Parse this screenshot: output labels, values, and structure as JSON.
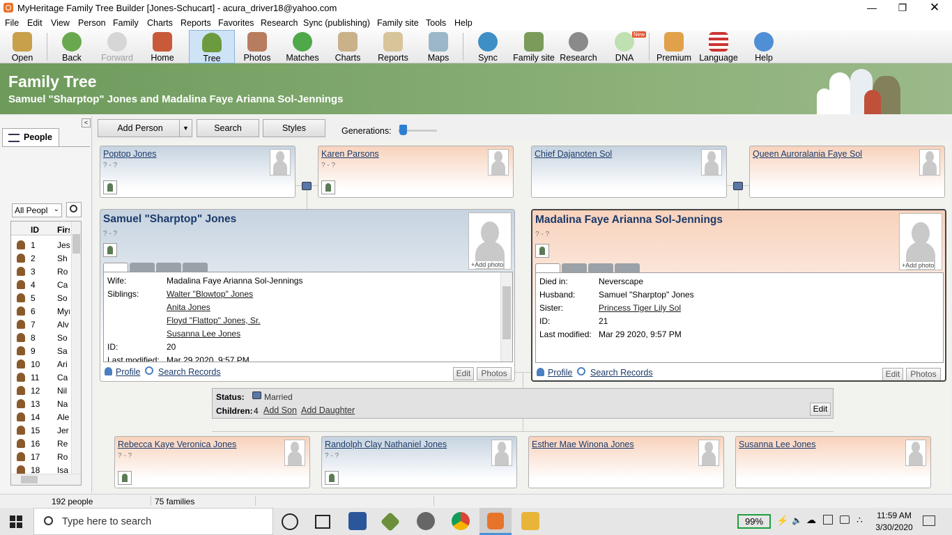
{
  "window": {
    "title": "MyHeritage Family Tree Builder [Jones-Schucart] - acura_driver18@yahoo.com"
  },
  "menu": [
    "File",
    "Edit",
    "View",
    "Person",
    "Family",
    "Charts",
    "Reports",
    "Favorites",
    "Research",
    "Sync (publishing)",
    "Family site",
    "Tools",
    "Help"
  ],
  "toolbar": {
    "items": [
      {
        "label": "Open",
        "icon": "folder-icon"
      },
      {
        "label": "Back",
        "icon": "back-arrow-icon"
      },
      {
        "label": "Forward",
        "icon": "forward-arrow-icon"
      },
      {
        "label": "Home",
        "icon": "house-icon"
      },
      {
        "label": "Tree",
        "icon": "tree-icon"
      },
      {
        "label": "Photos",
        "icon": "photos-icon"
      },
      {
        "label": "Matches",
        "icon": "matches-icon"
      },
      {
        "label": "Charts",
        "icon": "charts-icon"
      },
      {
        "label": "Reports",
        "icon": "reports-icon"
      },
      {
        "label": "Maps",
        "icon": "maps-icon"
      },
      {
        "label": "Sync",
        "icon": "sync-icon"
      },
      {
        "label": "Family site",
        "icon": "family-site-icon"
      },
      {
        "label": "Research",
        "icon": "research-icon"
      },
      {
        "label": "DNA",
        "icon": "dna-icon"
      },
      {
        "label": "Premium",
        "icon": "premium-icon"
      },
      {
        "label": "Language",
        "icon": "flag-icon"
      },
      {
        "label": "Help",
        "icon": "help-icon"
      }
    ],
    "new_badge": "New"
  },
  "banner": {
    "title": "Family Tree",
    "subtitle": "Samuel \"Sharptop\" Jones and Madalina Faye Arianna Sol-Jennings"
  },
  "left_panel": {
    "tab_label": "People",
    "filter_value": "All Peopl",
    "col_id": "ID",
    "col_first": "Firs",
    "rows": [
      {
        "id": "1",
        "name": "Jes"
      },
      {
        "id": "2",
        "name": "Sh"
      },
      {
        "id": "3",
        "name": "Ro"
      },
      {
        "id": "4",
        "name": "Ca"
      },
      {
        "id": "5",
        "name": "So"
      },
      {
        "id": "6",
        "name": "Myı"
      },
      {
        "id": "7",
        "name": "Alv"
      },
      {
        "id": "8",
        "name": "So"
      },
      {
        "id": "9",
        "name": "Sa"
      },
      {
        "id": "10",
        "name": "Ari"
      },
      {
        "id": "11",
        "name": "Ca"
      },
      {
        "id": "12",
        "name": "Nil"
      },
      {
        "id": "13",
        "name": "Na"
      },
      {
        "id": "14",
        "name": "Ale"
      },
      {
        "id": "15",
        "name": "Jer"
      },
      {
        "id": "16",
        "name": "Re"
      },
      {
        "id": "17",
        "name": "Ro"
      },
      {
        "id": "18",
        "name": "Isa"
      }
    ]
  },
  "controls": {
    "add_person": "Add Person",
    "search": "Search",
    "styles": "Styles",
    "generations_label": "Generations:",
    "generations_level": 0.1
  },
  "parents": [
    {
      "name": "Poptop Jones",
      "dates": "? - ?"
    },
    {
      "name": "Karen Parsons",
      "dates": "? - ?"
    },
    {
      "name": "Chief Dajanoten Sol",
      "dates": ""
    },
    {
      "name": "Queen Auroralania Faye Sol",
      "dates": ""
    }
  ],
  "husband": {
    "name": "Samuel \"Sharptop\" Jones",
    "dates": "? - ?",
    "add_photo": "Add photo",
    "rows": [
      {
        "k": "Wife:",
        "v": "Madalina Faye Arianna Sol-Jennings",
        "link": false
      },
      {
        "k": "Siblings:",
        "v": "Walter \"Blowtop\" Jones",
        "link": true
      },
      {
        "k": "",
        "v": "Anita Jones",
        "link": true
      },
      {
        "k": "",
        "v": "Floyd \"Flattop\" Jones, Sr.",
        "link": true
      },
      {
        "k": "",
        "v": "Susanna Lee Jones",
        "link": true
      },
      {
        "k": "ID:",
        "v": "20",
        "link": false
      },
      {
        "k": "Last modified:",
        "v": "Mar 29 2020, 9:57 PM",
        "link": false
      }
    ],
    "profile": "Profile",
    "search_records": "Search Records",
    "edit": "Edit",
    "photos": "Photos"
  },
  "wife": {
    "name": "Madalina Faye Arianna Sol-Jennings",
    "dates": "? - ?",
    "add_photo": "Add photo",
    "rows": [
      {
        "k": "Died in:",
        "v": "Neverscape",
        "link": false
      },
      {
        "k": "Husband:",
        "v": "Samuel \"Sharptop\" Jones",
        "link": false
      },
      {
        "k": "Sister:",
        "v": "Princess Tiger Lily Sol",
        "link": true
      },
      {
        "k": "ID:",
        "v": "21",
        "link": false
      },
      {
        "k": "Last modified:",
        "v": "Mar 29 2020, 9:57 PM",
        "link": false
      }
    ],
    "profile": "Profile",
    "search_records": "Search Records",
    "edit": "Edit",
    "photos": "Photos"
  },
  "family": {
    "status_label": "Status:",
    "status_value": "Married",
    "children_label": "Children:",
    "children_count": "4",
    "add_son": "Add Son",
    "add_daughter": "Add Daughter",
    "edit": "Edit"
  },
  "children": [
    {
      "name": "Rebecca Kaye Veronica Jones",
      "dates": "? - ?",
      "sex": "f"
    },
    {
      "name": "Randolph Clay Nathaniel Jones",
      "dates": "? - ?",
      "sex": "m"
    },
    {
      "name": "Esther Mae Winona Jones",
      "dates": "",
      "sex": "f"
    },
    {
      "name": "Susanna Lee Jones",
      "dates": "",
      "sex": "f"
    }
  ],
  "statusbar": {
    "people": "192 people",
    "families": "75 families"
  },
  "taskbar": {
    "search_placeholder": "Type here to search",
    "battery": "99%",
    "time": "11:59 AM",
    "date": "3/30/2020"
  }
}
